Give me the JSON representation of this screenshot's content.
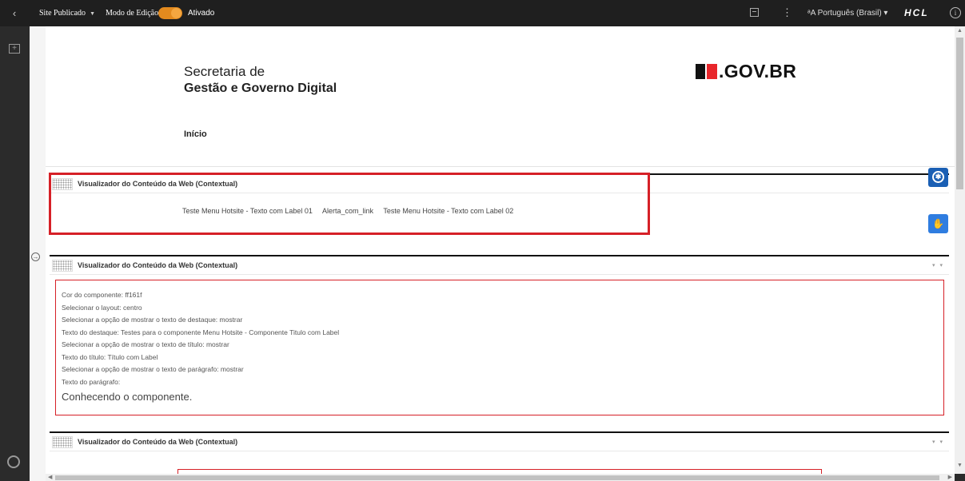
{
  "topbar": {
    "back_icon": "chevron-left",
    "site_label": "Site Publicado",
    "modo_label": "Modo de Edição:",
    "toggle_state": "Ativado",
    "language": "Português (Brasil)",
    "brand": "HCL"
  },
  "header": {
    "sec_line1": "Secretaria de",
    "sec_line2": "Gestão e Governo Digital",
    "logo_text": ".GOV.BR",
    "nav_inicio": "Início"
  },
  "portlet1": {
    "title": "Visualizador do Conteúdo da Web (Contextual)",
    "links": [
      "Teste Menu Hotsite - Texto com Label 01",
      "Alerta_com_link",
      "Teste Menu Hotsite - Texto com Label 02"
    ]
  },
  "portlet2": {
    "title": "Visualizador do Conteúdo da Web (Contextual)",
    "lines": [
      "Cor do componente: ff161f",
      "Selecionar o layout: centro",
      "Selecionar a opção de mostrar o texto de destaque: mostrar",
      "Texto do destaque: Testes para o componente Menu Hotsite - Componente Titulo com Label",
      "Selecionar a opção de mostrar o texto de título: mostrar",
      "Texto do título: Título com Label",
      "Selecionar a opção de mostrar o texto de parágrafo: mostrar",
      "Texto do parágrafo:"
    ],
    "paragraph": "Conhecendo o componente."
  },
  "portlet3": {
    "title": "Visualizador do Conteúdo da Web (Contextual)"
  },
  "colors": {
    "accent_orange": "#e38a1e",
    "highlight_red": "#d62027",
    "accessibility_blue": "#1a5fb4"
  }
}
